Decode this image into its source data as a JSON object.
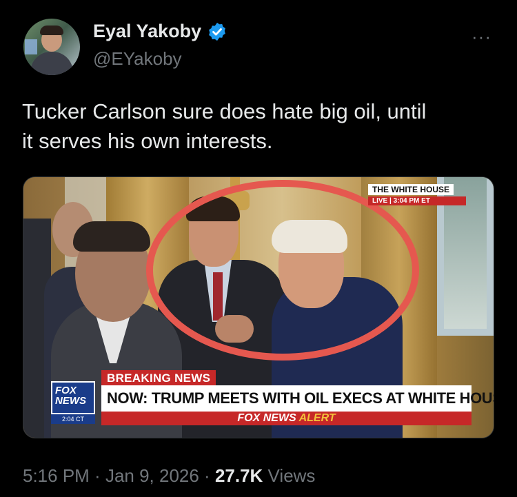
{
  "user": {
    "display_name": "Eyal Yakoby",
    "handle": "@EYakoby",
    "verified_color": "#1d9bf0"
  },
  "more_label": "···",
  "tweet": {
    "text_line1": "Tucker Carlson sure does hate big oil, until",
    "text_line2": "it serves his own interests."
  },
  "media": {
    "corner_title": "THE WHITE HOUSE",
    "corner_live": "LIVE  |  3:04 PM ET",
    "breaking_label": "BREAKING",
    "breaking_news_word": "NEWS",
    "headline": "NOW: TRUMP MEETS WITH OIL EXECS AT WHITE HOUSE",
    "alert_brand": "FOX NEWS",
    "alert_word": "ALERT",
    "logo_line1": "FOX",
    "logo_line2": "NEWS",
    "logo_time": "2:04 CT",
    "highlight_color": "#e5584f"
  },
  "meta": {
    "time": "5:16 PM",
    "separator": " · ",
    "date": "Jan 9, 2026",
    "views_count": "27.7K",
    "views_label": " Views"
  }
}
